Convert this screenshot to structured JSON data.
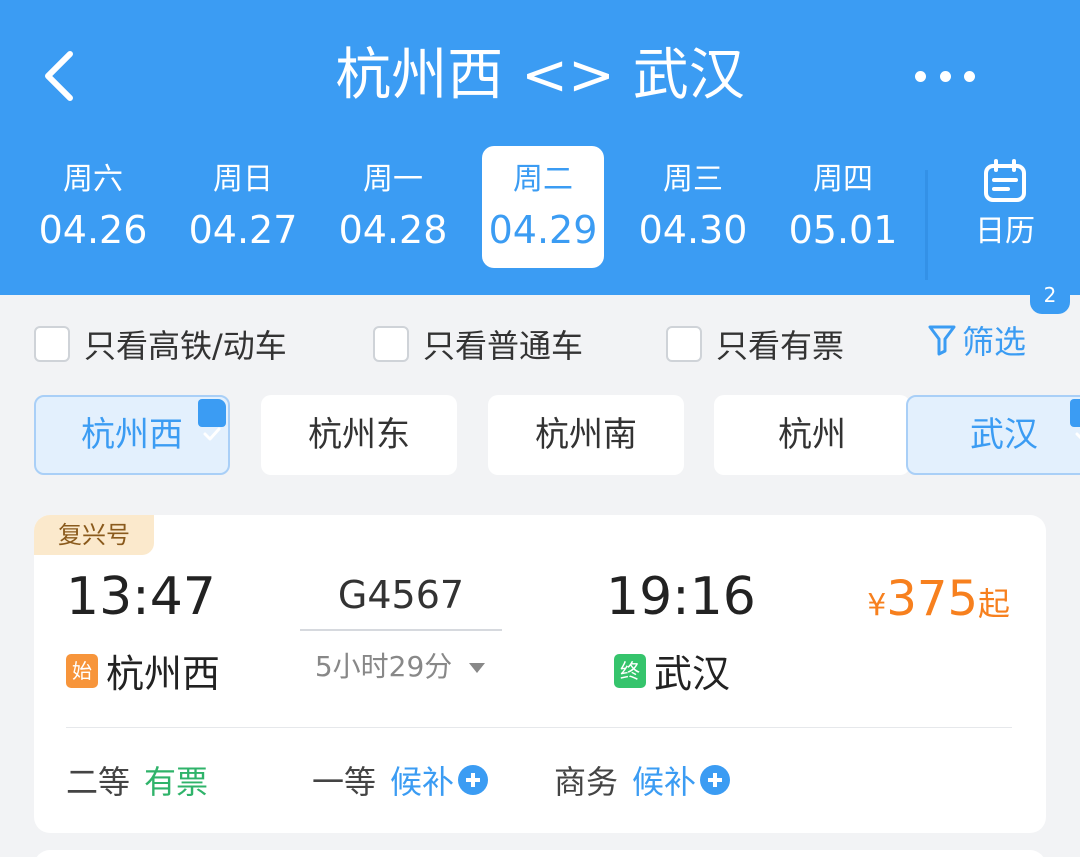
{
  "header": {
    "title": "杭州西 <> 武汉",
    "dates": [
      {
        "weekday": "周六",
        "date": "04.26"
      },
      {
        "weekday": "周日",
        "date": "04.27"
      },
      {
        "weekday": "周一",
        "date": "04.28"
      },
      {
        "weekday": "周二",
        "date": "04.29",
        "selected": true
      },
      {
        "weekday": "周三",
        "date": "04.30"
      },
      {
        "weekday": "周四",
        "date": "05.01"
      }
    ],
    "calendar_label": "日历",
    "badge": "2"
  },
  "filters": {
    "high_speed_only": "只看高铁/动车",
    "regular_only": "只看普通车",
    "available_only": "只看有票",
    "filter_label": "筛选"
  },
  "stations": [
    {
      "name": "杭州西",
      "selected": true
    },
    {
      "name": "杭州东",
      "selected": false
    },
    {
      "name": "杭州南",
      "selected": false
    },
    {
      "name": "杭州",
      "selected": false
    },
    {
      "name": "武汉",
      "selected": true
    }
  ],
  "train": {
    "tag": "复兴号",
    "depart_time": "13:47",
    "depart_badge": "始",
    "depart_station": "杭州西",
    "train_no": "G4567",
    "duration": "5小时29分",
    "arrive_time": "19:16",
    "arrive_badge": "终",
    "arrive_station": "武汉",
    "price_currency": "¥",
    "price_value": "375",
    "price_suffix": "起",
    "seats": [
      {
        "class": "二等",
        "status": "有票"
      },
      {
        "class": "一等",
        "status": "候补"
      },
      {
        "class": "商务",
        "status": "候补"
      }
    ]
  },
  "colors": {
    "header_blue": "#3b9cf3",
    "price_orange": "#f7801e",
    "available_green": "#2fb36a"
  }
}
